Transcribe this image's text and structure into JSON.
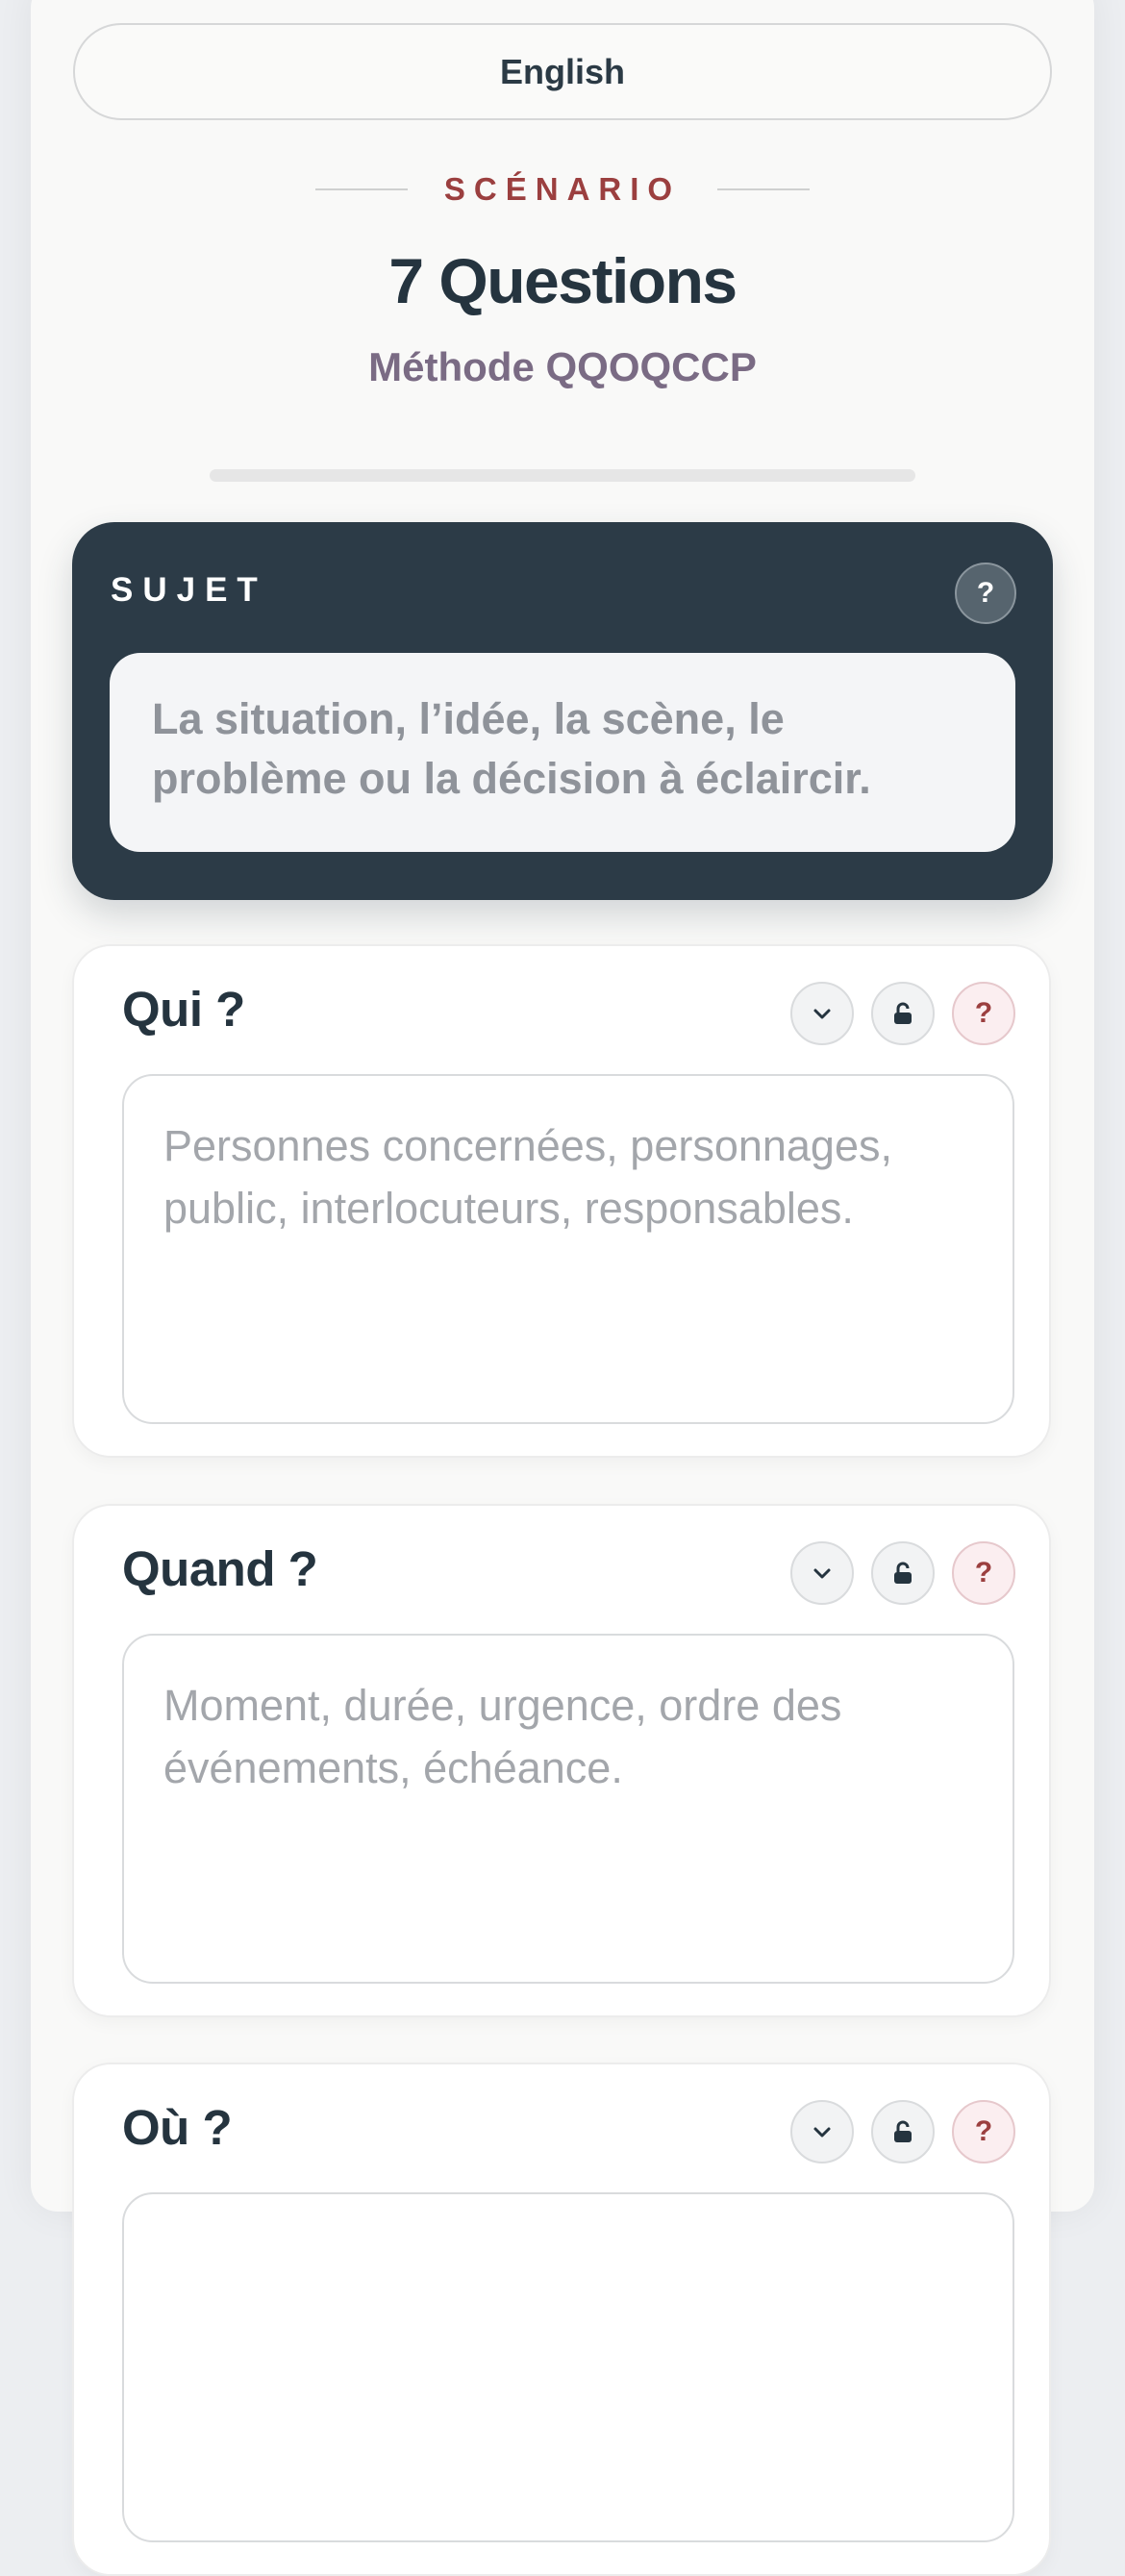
{
  "language_button": {
    "label": "English"
  },
  "header": {
    "eyebrow": "SCÉNARIO",
    "title": "7 Questions",
    "subtitle": "Méthode QQOQCCP",
    "progress": 0
  },
  "subject": {
    "label": "SUJET",
    "help_glyph": "?",
    "placeholder": "La situation, l’idée, la scène, le problème ou la décision à éclaircir."
  },
  "questions": [
    {
      "title": "Qui ?",
      "placeholder": "Personnes concernées, personnages, public, interlocuteurs, responsables.",
      "help_glyph": "?"
    },
    {
      "title": "Quand ?",
      "placeholder": "Moment, durée, urgence, ordre des événements, échéance.",
      "help_glyph": "?"
    },
    {
      "title": "Où ?",
      "placeholder": "",
      "help_glyph": "?"
    }
  ],
  "icons": {
    "collapse": "chevron-down-icon",
    "lock": "unlock-icon",
    "help": "help-icon"
  },
  "colors": {
    "accent": "#9b3f3f",
    "dark": "#2c3b47",
    "muted_purple": "#7a6b84"
  }
}
